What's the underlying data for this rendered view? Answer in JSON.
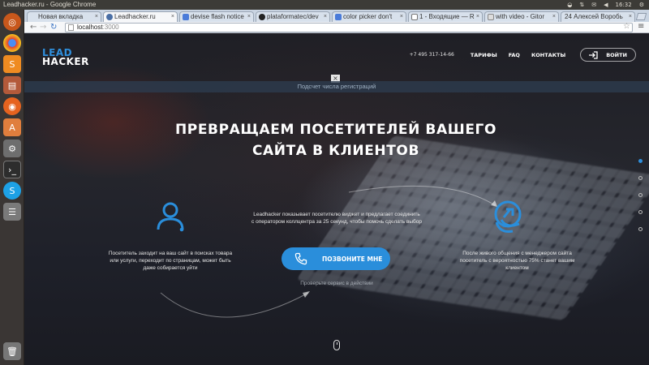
{
  "os": {
    "window_title": "Leadhacker.ru - Google Chrome",
    "time": "16:32"
  },
  "tabs": [
    {
      "label": "Новая вкладка",
      "active": false
    },
    {
      "label": "Leadhacker.ru",
      "active": true
    },
    {
      "label": "devise flash notice",
      "active": false
    },
    {
      "label": "plataformatec/dev",
      "active": false
    },
    {
      "label": "color picker don't",
      "active": false
    },
    {
      "label": "1 - Входящие — R",
      "active": false
    },
    {
      "label": "with video - Gitor",
      "active": false
    },
    {
      "label": "24 Алексей Воробь",
      "active": false
    }
  ],
  "address": {
    "host": "localhost",
    "port": ":3000"
  },
  "site": {
    "logo": {
      "line1": "LEAD",
      "line2": "HACKER"
    },
    "nav": {
      "phone": "+7 495 317-14-66",
      "tariffs": "ТАРИФЫ",
      "faq": "FAQ",
      "contacts": "КОНТАКТЫ",
      "login": "ВОЙТИ"
    },
    "notice": {
      "text": "Подсчет числа регистраций",
      "close": "×"
    },
    "hero": {
      "title": "ПРЕВРАЩАЕМ ПОСЕТИТЕЛЕЙ ВАШЕГО САЙТА В КЛИЕНТОВ"
    },
    "desc_left": "Посетитель заходит на ваш сайт в поисках товара или услуги, переходит по страницам, может быть даже собирается уйти",
    "desc_center": "Leadhacker показывает посетителю виджет и предлагает соединить с оператором коллцентра за 25 секунд, чтобы помочь сделать выбор",
    "desc_right": "После живого общения с менеджером сайта посетитель с вероятностью 75% станет вашим клиентом",
    "cta": "ПОЗВОНИТЕ МНЕ",
    "try_link": "Проверьте сервис в действии",
    "accent": "#2a8edb"
  }
}
